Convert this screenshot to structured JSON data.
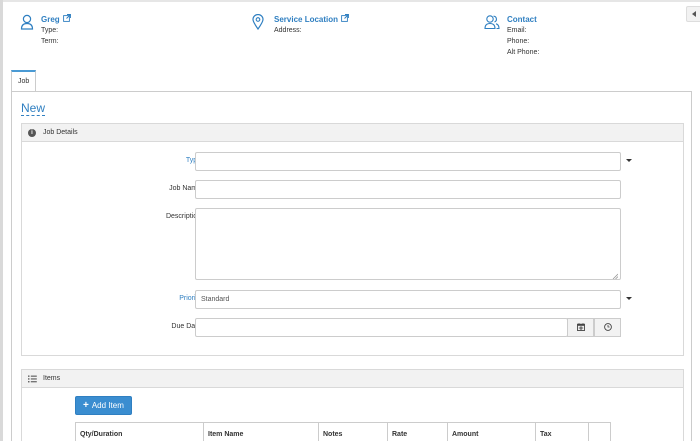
{
  "customer": {
    "name": "Greg",
    "type_label": "Type:",
    "term_label": "Term:"
  },
  "service_location": {
    "title": "Service Location",
    "address_label": "Address:"
  },
  "contact": {
    "title": "Contact",
    "email_label": "Email:",
    "phone_label": "Phone:",
    "alt_phone_label": "Alt Phone:"
  },
  "tabs": [
    {
      "label": "Job"
    }
  ],
  "page_title": "New",
  "job_details": {
    "header": "Job Details",
    "type": {
      "label": "Type",
      "value": ""
    },
    "job_name": {
      "label": "Job Name",
      "value": ""
    },
    "description": {
      "label": "Description",
      "value": ""
    },
    "priority": {
      "label": "Priority",
      "value": "Standard"
    },
    "due_date": {
      "label": "Due Date",
      "value": ""
    }
  },
  "items": {
    "header": "Items",
    "add_button": "Add Item",
    "columns": [
      "Qty/Duration",
      "Item Name",
      "Notes",
      "Rate",
      "Amount",
      "Tax"
    ]
  },
  "colors": {
    "accent": "#2f7fc1",
    "button": "#3a8dd0",
    "tab_accent": "#4a9ad4"
  }
}
